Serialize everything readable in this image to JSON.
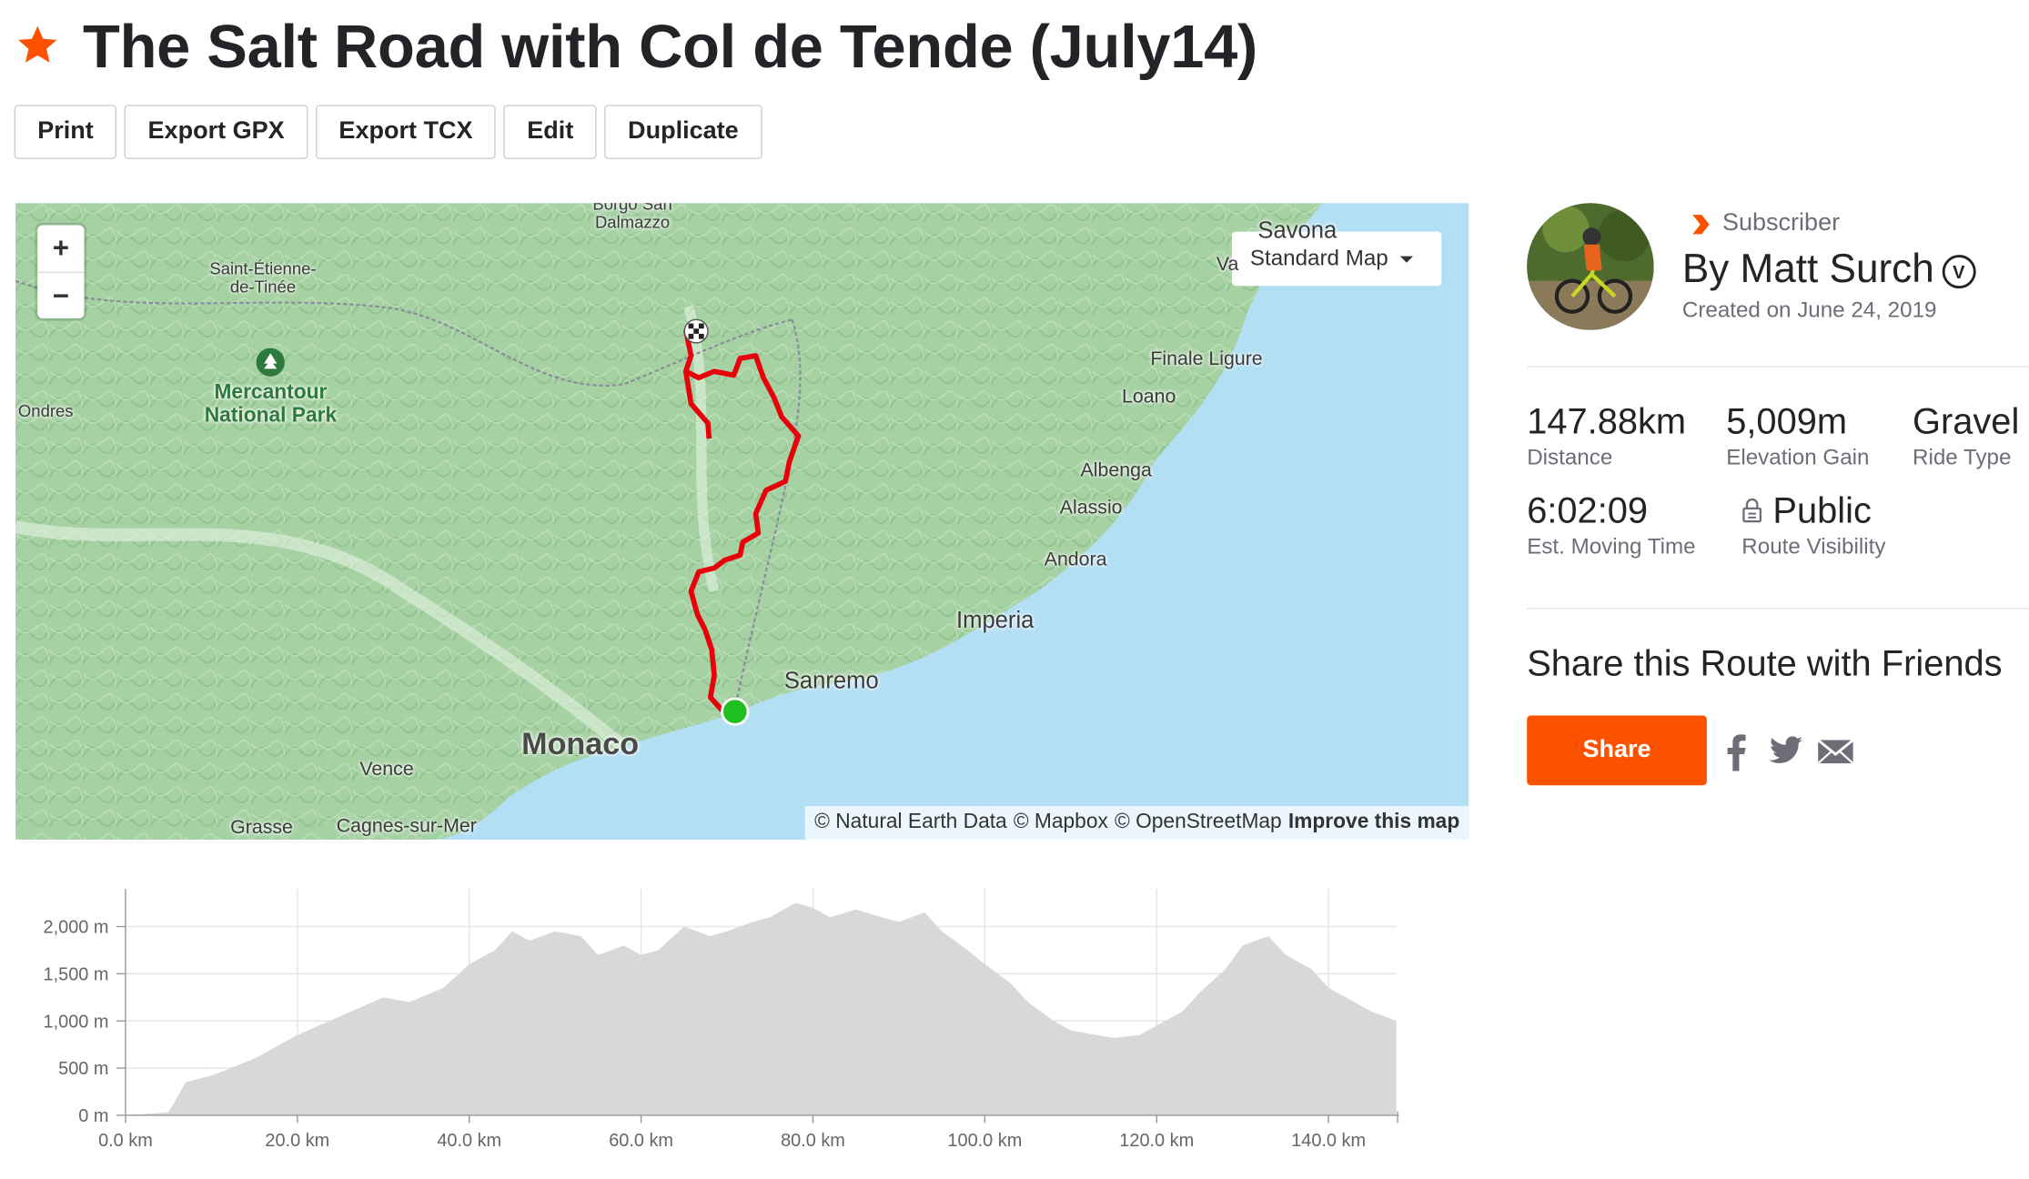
{
  "route": {
    "title": "The Salt Road with Col de Tende (July14)",
    "starred": true
  },
  "toolbar": {
    "print": "Print",
    "export_gpx": "Export GPX",
    "export_tcx": "Export TCX",
    "edit": "Edit",
    "duplicate": "Duplicate"
  },
  "map": {
    "zoom_in": "+",
    "zoom_out": "−",
    "style_selector": "Standard Map",
    "labels": {
      "borgo": "Borgo San\nDalmazzo",
      "savona": "Savona",
      "va": "Va",
      "saint_etienne": "Saint-Étienne-\nde-Tinée",
      "ondres": "Ondres",
      "mercantour": "Mercantour\nNational Park",
      "finale": "Finale Ligure",
      "loano": "Loano",
      "albenga": "Albenga",
      "alassio": "Alassio",
      "andora": "Andora",
      "imperia": "Imperia",
      "sanremo": "Sanremo",
      "monaco": "Monaco",
      "vence": "Vence",
      "grasse": "Grasse",
      "cagnes": "Cagnes-sur-Mer"
    },
    "attribution": {
      "natural_earth": "© Natural Earth Data",
      "mapbox": "© Mapbox",
      "osm": "© OpenStreetMap",
      "improve": "Improve this map"
    },
    "colors": {
      "route": "#e8000b",
      "start": "#1fbf1f",
      "sea": "#b3dff5",
      "land": "#9fcf9f"
    }
  },
  "elevation_chart": {
    "chart_data": {
      "type": "area",
      "x_unit": "km",
      "y_unit": "m",
      "x": [
        0,
        5,
        7,
        10,
        15,
        20,
        25,
        30,
        33,
        37,
        40,
        43,
        45,
        47,
        50,
        53,
        55,
        58,
        60,
        62,
        65,
        68,
        70,
        73,
        75,
        78,
        80,
        82,
        85,
        88,
        90,
        93,
        95,
        98,
        100,
        103,
        105,
        108,
        110,
        113,
        115,
        118,
        120,
        123,
        125,
        128,
        130,
        133,
        135,
        138,
        140,
        143,
        145,
        147.88
      ],
      "y": [
        0,
        30,
        350,
        420,
        600,
        850,
        1050,
        1250,
        1200,
        1350,
        1600,
        1750,
        1950,
        1850,
        1950,
        1900,
        1700,
        1800,
        1700,
        1750,
        2000,
        1900,
        1950,
        2050,
        2100,
        2250,
        2200,
        2100,
        2180,
        2100,
        2050,
        2150,
        1950,
        1750,
        1600,
        1400,
        1200,
        1000,
        900,
        850,
        820,
        850,
        950,
        1100,
        1300,
        1550,
        1800,
        1900,
        1700,
        1550,
        1350,
        1200,
        1100,
        1000
      ],
      "xticks": [
        "0.0 km",
        "20.0 km",
        "40.0 km",
        "60.0 km",
        "80.0 km",
        "100.0 km",
        "120.0 km",
        "140.0 km"
      ],
      "yticks": [
        "0 m",
        "500 m",
        "1,000 m",
        "1,500 m",
        "2,000 m"
      ],
      "xlim": [
        0,
        147.88
      ],
      "ylim": [
        0,
        2400
      ],
      "grid": true,
      "fill_color": "#d8d8d8"
    }
  },
  "author": {
    "badge": "Subscriber",
    "name": "By Matt Surch",
    "created": "Created on June 24, 2019"
  },
  "stats": {
    "distance": {
      "value": "147.88km",
      "label": "Distance"
    },
    "elevation": {
      "value": "5,009m",
      "label": "Elevation Gain"
    },
    "ride_type": {
      "value": "Gravel",
      "label": "Ride Type"
    },
    "moving_time": {
      "value": "6:02:09",
      "label": "Est. Moving Time"
    },
    "visibility": {
      "value": "Public",
      "label": "Route Visibility"
    }
  },
  "share": {
    "title": "Share this Route with Friends",
    "button": "Share"
  },
  "colors": {
    "accent": "#fc5200",
    "text": "#242428",
    "muted": "#6d6d78"
  }
}
